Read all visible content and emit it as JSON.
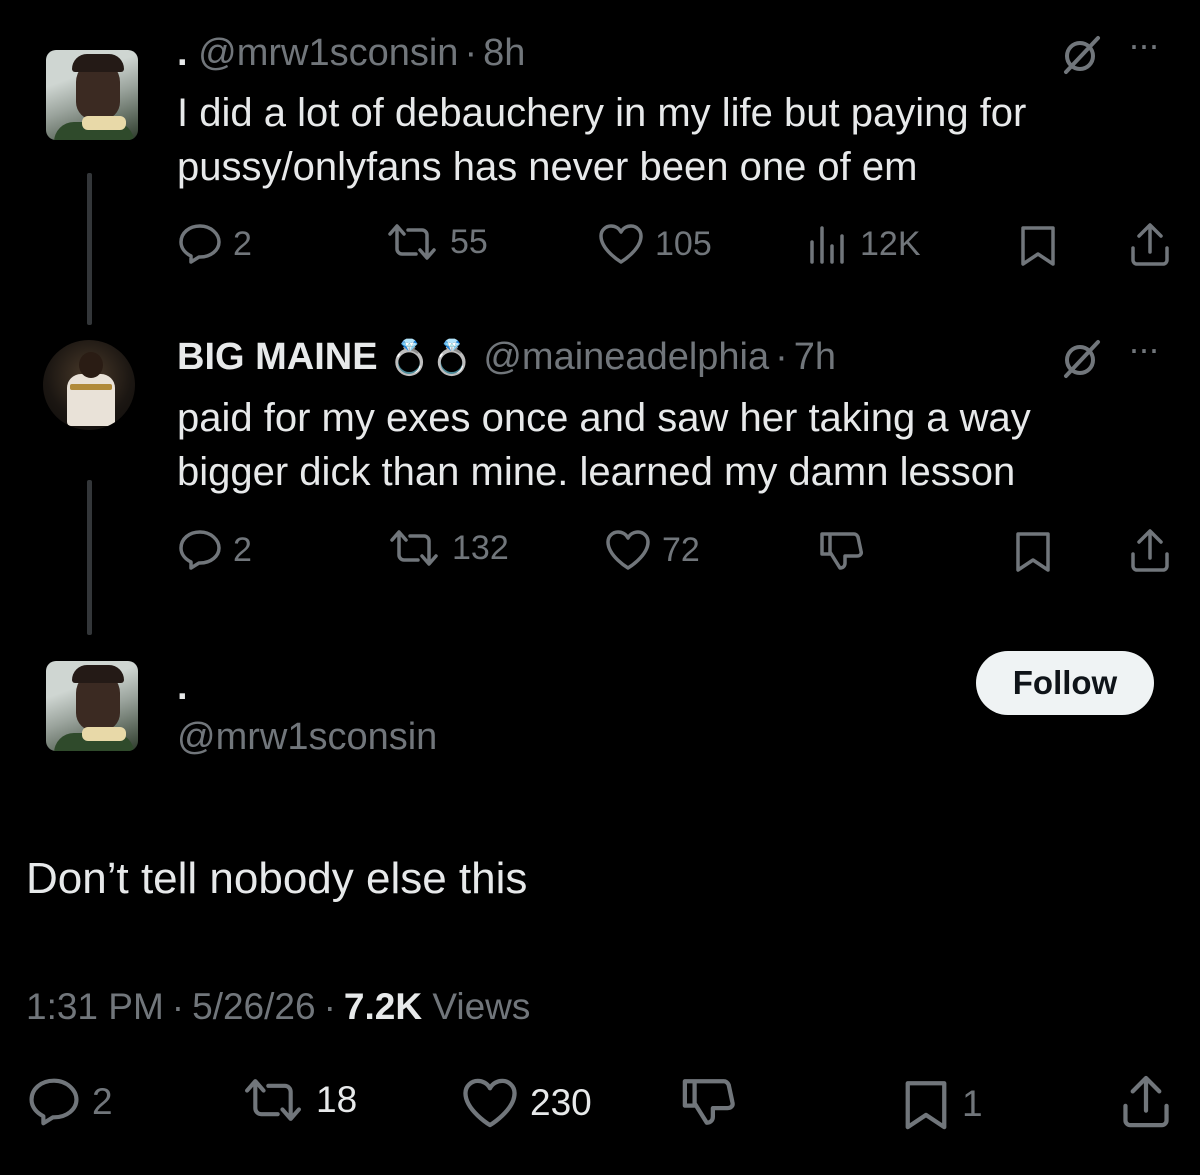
{
  "tweet1": {
    "display_name": ".",
    "handle": "@mrw1sconsin",
    "sep": "·",
    "time": "8h",
    "text_line1": "I did a lot of debauchery in my life but paying for",
    "text_line2": "pussy/onlyfans has never been one of em",
    "replies": "2",
    "retweets": "55",
    "likes": "105",
    "views": "12K"
  },
  "tweet2": {
    "display_name": "BIG MAINE",
    "emoji": "💍💍",
    "handle": "@maineadelphia",
    "sep": "·",
    "time": "7h",
    "text_line1": "paid for my exes once and saw her taking a way",
    "text_line2": "bigger dick than mine. learned my damn lesson",
    "replies": "2",
    "retweets": "132",
    "likes": "72"
  },
  "main_tweet": {
    "display_name": ".",
    "handle": "@mrw1sconsin",
    "follow_label": "Follow",
    "text": "Don’t tell nobody else this",
    "time": "1:31 PM",
    "date": "5/26/26",
    "sep": "·",
    "views_count": "7.2K",
    "views_label": "Views",
    "replies": "2",
    "retweets": "18",
    "likes": "230",
    "bookmarks": "1"
  },
  "more_glyph": "···",
  "colors": {
    "background": "#000000",
    "text": "#e7e9ea",
    "muted": "#71767b",
    "follow_bg": "#eff3f4"
  },
  "icons": [
    "grok-icon",
    "more-icon",
    "reply-icon",
    "retweet-icon",
    "like-icon",
    "views-icon",
    "bookmark-icon",
    "share-icon",
    "dislike-icon"
  ]
}
